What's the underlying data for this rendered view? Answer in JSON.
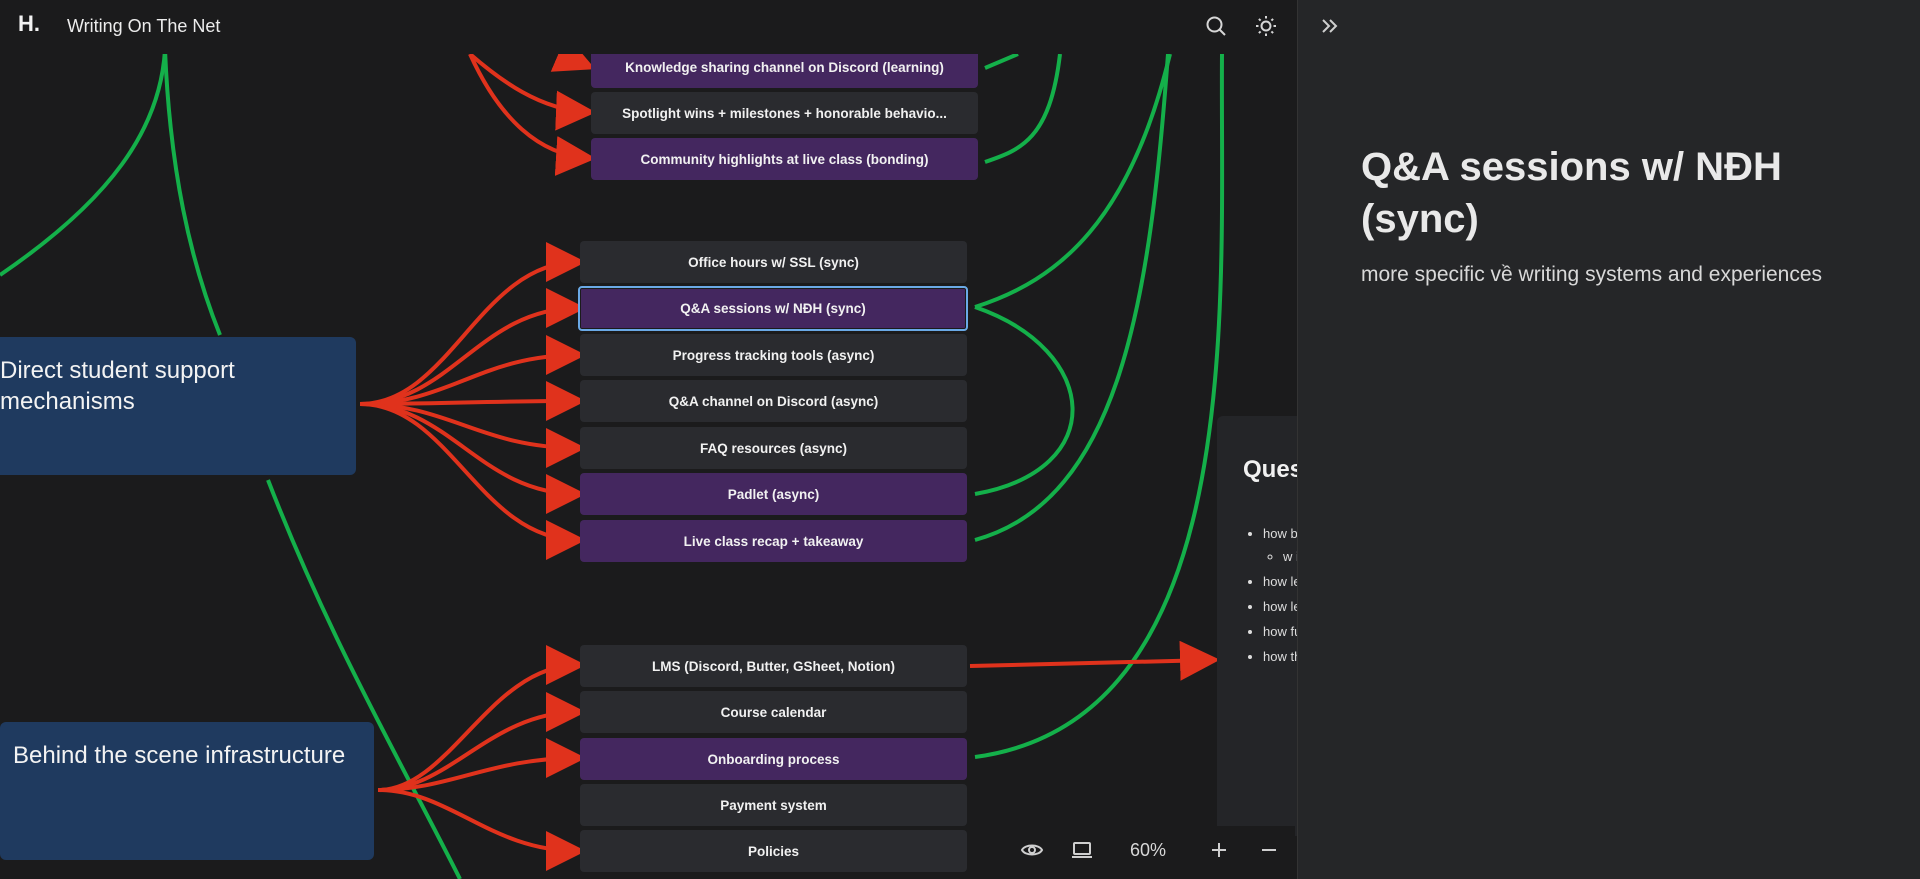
{
  "header": {
    "title": "Writing On The Net",
    "logo_text": "H."
  },
  "canvas_nodes": {
    "knowledge": "Knowledge sharing channel on Discord (learning)",
    "spotlight": "Spotlight wins + milestones + honorable behavio...",
    "community": "Community highlights at live class (bonding)",
    "office_hours": "Office hours w/ SSL (sync)",
    "qa_sessions": "Q&A sessions w/ NĐH (sync)",
    "progress": "Progress tracking tools (async)",
    "qa_channel": "Q&A channel on Discord (async)",
    "faq": "FAQ resources (async)",
    "padlet": "Padlet (async)",
    "recap": "Live class recap + takeaway",
    "lms": "LMS (Discord, Butter, GSheet, Notion)",
    "calendar": "Course calendar",
    "onboarding": "Onboarding process",
    "payment": "Payment system",
    "policies": "Policies"
  },
  "groups": {
    "direct_support": "Direct student support mechanisms",
    "behind_scene": "Behind the scene infrastructure"
  },
  "peek_card": {
    "title": "Questions Tools",
    "items": [
      "how bloggers over",
      "how learn",
      "how learn",
      "how full s each",
      "how the s"
    ],
    "subitem": "w i"
  },
  "zoom": {
    "level": "60%"
  },
  "detail_panel": {
    "title": "Q&A sessions w/ NĐH (sync)",
    "description": "more specific về writing systems and experiences"
  },
  "icons": [
    "logo-icon",
    "search-icon",
    "theme-toggle-icon",
    "collapse-panel-icon",
    "preview-icon",
    "present-icon",
    "zoom-in-icon",
    "zoom-out-icon"
  ],
  "colors": {
    "red_edge": "#e0321c",
    "green_edge": "#14b04a",
    "purple_node": "#44275f",
    "blue_group": "#1f3a5f",
    "selected_border": "#6aa9e6"
  }
}
